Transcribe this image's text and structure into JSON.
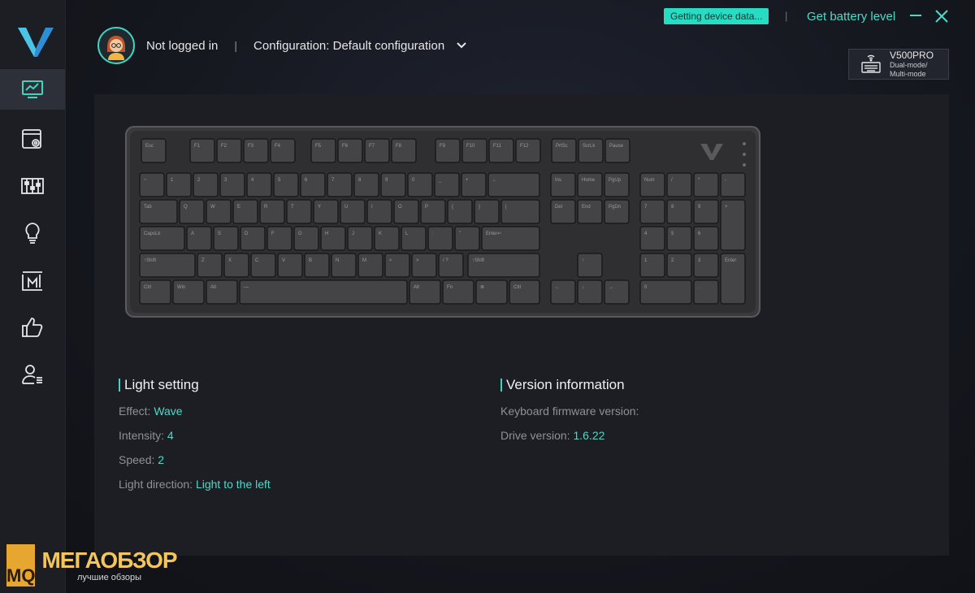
{
  "header": {
    "user_status": "Not logged in",
    "separator": "|",
    "configuration_label": "Configuration: Default configuration",
    "status_pill": "Getting device data...",
    "battery_link": "Get battery level"
  },
  "device": {
    "name": "V500PRO",
    "mode_line1": "Dual-mode/",
    "mode_line2": "Multi-mode"
  },
  "light_setting": {
    "title": "Light setting",
    "effect_label": "Effect:",
    "effect_value": "Wave",
    "intensity_label": "Intensity:",
    "intensity_value": "4",
    "speed_label": "Speed:",
    "speed_value": "2",
    "direction_label": "Light direction:",
    "direction_value": "Light to the left"
  },
  "version_info": {
    "title": "Version information",
    "firmware_label": "Keyboard firmware version:",
    "firmware_value": "",
    "driver_label": "Drive version:",
    "driver_value": "1.6.22"
  },
  "sidebar": {
    "items": [
      {
        "icon": "monitor-chart-icon"
      },
      {
        "icon": "screen-settings-icon"
      },
      {
        "icon": "sliders-icon"
      },
      {
        "icon": "lightbulb-icon"
      },
      {
        "icon": "macro-icon"
      },
      {
        "icon": "thumbs-up-icon"
      },
      {
        "icon": "user-list-icon"
      }
    ]
  },
  "watermark": {
    "badge": "MQ",
    "title": "МЕГАОБЗОР",
    "subtitle": "лучшие обзоры"
  },
  "colors": {
    "accent": "#3fd4c0",
    "pill": "#26dcc2",
    "background": "#15171e",
    "panel": "#1d1e23"
  },
  "keyboard": {
    "function_row": [
      "Esc",
      "F1",
      "F2",
      "F3",
      "F4",
      "F5",
      "F6",
      "F7",
      "F8",
      "F9",
      "F10",
      "F11",
      "F12",
      "PrtSc",
      "ScrLk",
      "Pause"
    ],
    "row1": [
      "~",
      "1",
      "2",
      "3",
      "4",
      "5",
      "6",
      "7",
      "8",
      "9",
      "0",
      "_",
      "+",
      "←",
      "Ins",
      "Home",
      "PgUp",
      "Num",
      "/",
      "*",
      "-"
    ],
    "row2": [
      "Tab",
      "Q",
      "W",
      "E",
      "R",
      "T",
      "Y",
      "U",
      "I",
      "O",
      "P",
      "{",
      "}",
      "|",
      "Del",
      "End",
      "PgDn",
      "7",
      "8",
      "9",
      "+"
    ],
    "row3": [
      "CapsLk",
      "A",
      "S",
      "D",
      "F",
      "G",
      "H",
      "J",
      "K",
      "L",
      ":",
      "\"",
      "Enter↵",
      "4",
      "5",
      "6"
    ],
    "row4": [
      "↑Shift",
      "Z",
      "X",
      "C",
      "V",
      "B",
      "N",
      "M",
      "<",
      ">",
      "/ ?",
      "↑Shift",
      "↑",
      "1",
      "2",
      "3",
      "Enter"
    ],
    "row5": [
      "Ctrl",
      "Win",
      "Alt",
      "—",
      "Alt",
      "Fn",
      "≣",
      "Ctrl",
      "←",
      "↓",
      "→",
      "0",
      "."
    ]
  }
}
